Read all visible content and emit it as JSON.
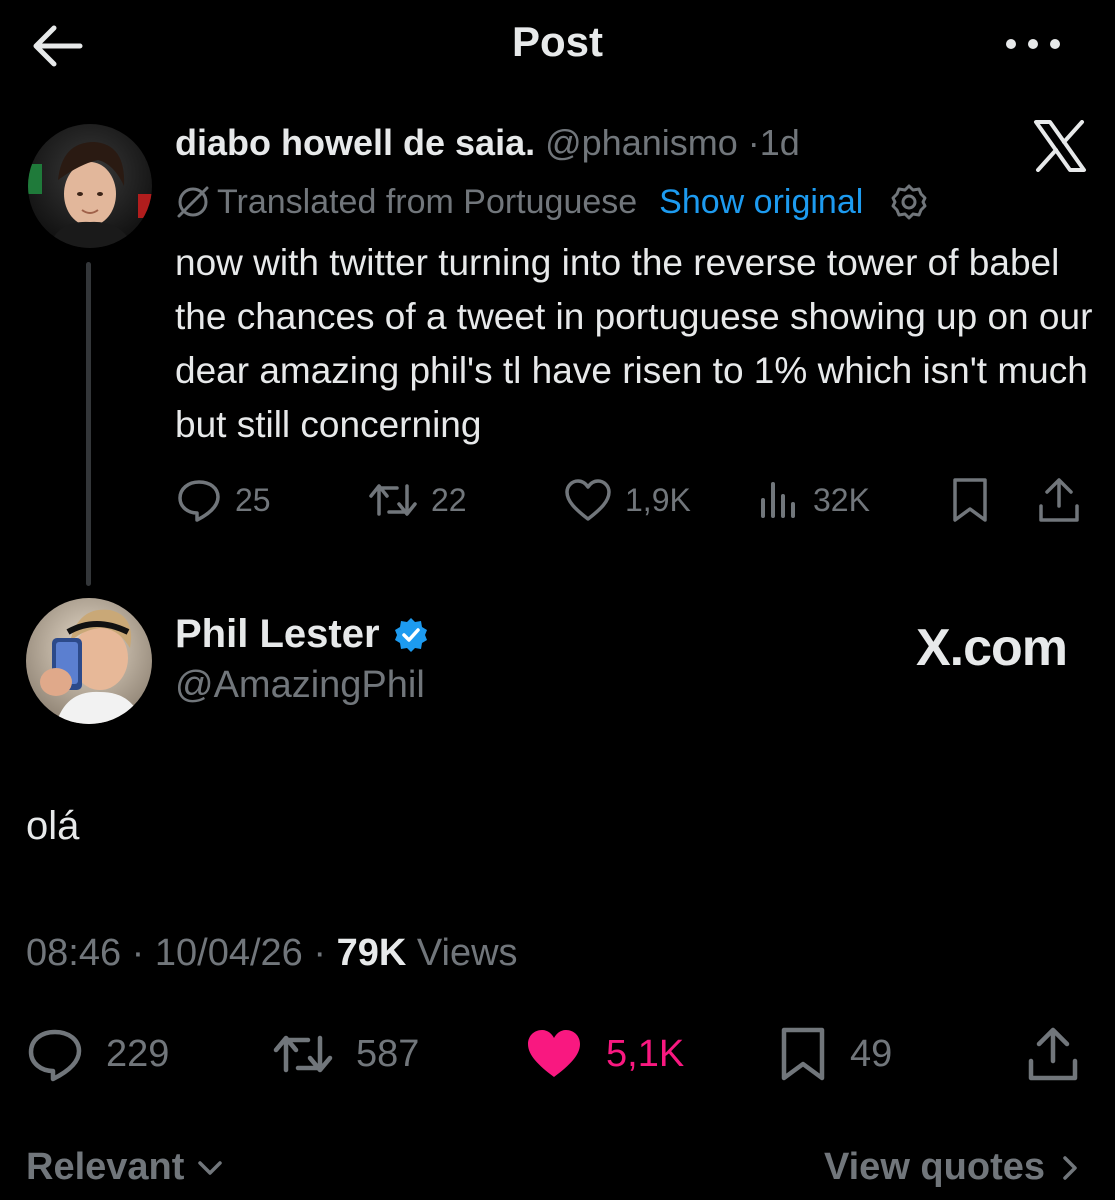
{
  "header": {
    "title": "Post"
  },
  "quoted_post": {
    "author_name": "diabo howell de saia.",
    "author_handle": "@phanismo",
    "separator": "·",
    "time": "1d",
    "translated_label": "Translated from Portuguese",
    "show_original_label": "Show original",
    "text": "now with twitter turning into the reverse tower of babel the chances of a tweet in portuguese showing up on our dear amazing phil's tl have risen to 1% which isn't much but still concerning",
    "replies": "25",
    "reposts": "22",
    "likes": "1,9K",
    "views": "32K"
  },
  "main_post": {
    "author_name": "Phil Lester",
    "author_handle": "@AmazingPhil",
    "brand_text": "X.com",
    "text": "olá",
    "time": "08:46",
    "date": "10/04/26",
    "views_count": "79K",
    "views_label": "Views",
    "replies": "229",
    "reposts": "587",
    "likes": "5,1K",
    "bookmarks": "49"
  },
  "footer": {
    "sort_label": "Relevant",
    "view_quotes_label": "View quotes"
  },
  "colors": {
    "background": "#000000",
    "text": "#e7e9ea",
    "muted": "#71767b",
    "link": "#1d9bf0",
    "like": "#f91880",
    "verified": "#1d9bf0"
  },
  "icons": [
    "back-arrow-icon",
    "more-icon",
    "x-logo-icon",
    "translate-icon",
    "gear-icon",
    "reply-icon",
    "repost-icon",
    "like-icon",
    "views-icon",
    "bookmark-icon",
    "share-icon",
    "verified-badge-icon",
    "chevron-down-icon",
    "chevron-right-icon"
  ]
}
